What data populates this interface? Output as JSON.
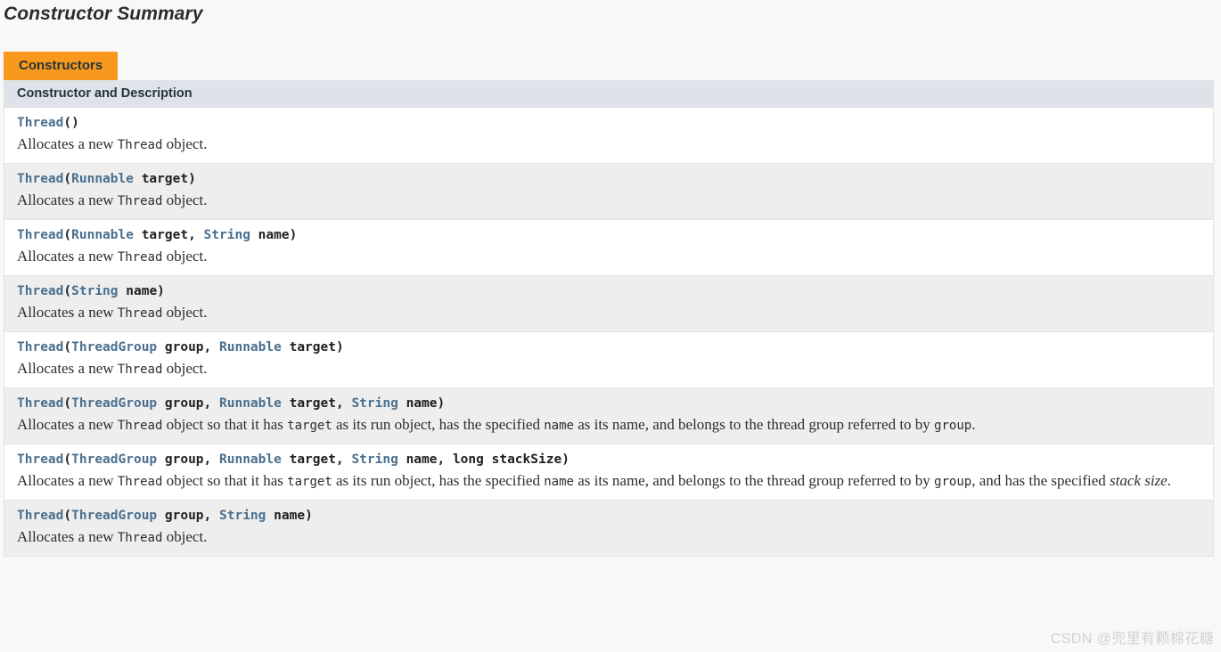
{
  "page": {
    "section_title": "Constructor Summary",
    "background_color": "#f8f8f8"
  },
  "tabs": {
    "active_label": "Constructors",
    "active_color": "#f8981d"
  },
  "table": {
    "header": "Constructor and Description",
    "header_bg": "#dee3ea",
    "link_color": "#4a6f8e",
    "alt_row_bg": "#eeeeee",
    "rows": [
      {
        "signature": "Thread()",
        "description": "Allocates a new Thread object."
      },
      {
        "signature": "Thread(Runnable target)",
        "description": "Allocates a new Thread object."
      },
      {
        "signature": "Thread(Runnable target, String name)",
        "description": "Allocates a new Thread object."
      },
      {
        "signature": "Thread(String name)",
        "description": "Allocates a new Thread object."
      },
      {
        "signature": "Thread(ThreadGroup group, Runnable target)",
        "description": "Allocates a new Thread object."
      },
      {
        "signature": "Thread(ThreadGroup group, Runnable target, String name)",
        "description": "Allocates a new Thread object so that it has target as its run object, has the specified name as its name, and belongs to the thread group referred to by group."
      },
      {
        "signature": "Thread(ThreadGroup group, Runnable target, String name, long stackSize)",
        "description": "Allocates a new Thread object so that it has target as its run object, has the specified name as its name, and belongs to the thread group referred to by group, and has the specified stack size."
      },
      {
        "signature": "Thread(ThreadGroup group, String name)",
        "description": "Allocates a new Thread object."
      }
    ]
  },
  "watermark": {
    "text": "CSDN @兜里有颗棉花糖"
  }
}
